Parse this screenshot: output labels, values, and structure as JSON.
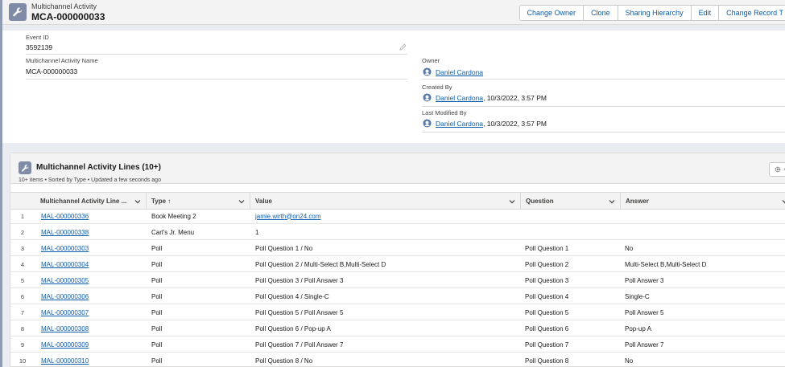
{
  "header": {
    "object_label": "Multichannel Activity",
    "record_title": "MCA-000000033",
    "icon": "wrench-icon",
    "actions": [
      "Change Owner",
      "Clone",
      "Sharing Hierarchy",
      "Edit",
      "Change Record T"
    ]
  },
  "detail": {
    "event_id_label": "Event ID",
    "event_id_value": "3592139",
    "name_label": "Multichannel Activity Name",
    "name_value": "MCA-000000033",
    "owner_label": "Owner",
    "owner_value": "Daniel Cardona",
    "created_label": "Created By",
    "created_user": "Daniel Cardona",
    "created_date": ", 10/3/2022, 3:57 PM",
    "modified_label": "Last Modified By",
    "modified_user": "Daniel Cardona",
    "modified_date": ", 10/3/2022, 3:57 PM"
  },
  "related_list": {
    "title": "Multichannel Activity Lines (10+)",
    "subtitle": "10+ items • Sorted by Type • Updated a few seconds ago",
    "columns": {
      "name": "Multichannel Activity Line ...",
      "type": "Type ↑",
      "value": "Value",
      "question": "Question",
      "answer": "Answer"
    },
    "rows": [
      {
        "num": "1",
        "name": "MAL-000000336",
        "type": "Book Meeting 2",
        "value": "jamie.wirth@on24.com",
        "question": "",
        "answer": ""
      },
      {
        "num": "2",
        "name": "MAL-000000338",
        "type": "Carl's Jr. Menu",
        "value": "1",
        "question": "",
        "answer": ""
      },
      {
        "num": "3",
        "name": "MAL-000000303",
        "type": "Poll",
        "value": "Poll Question 1 / No",
        "question": "Poll Question 1",
        "answer": "No"
      },
      {
        "num": "4",
        "name": "MAL-000000304",
        "type": "Poll",
        "value": "Poll Question 2 / Multi-Select B,Multi-Select D",
        "question": "Poll Question 2",
        "answer": "Multi-Select B,Multi-Select D"
      },
      {
        "num": "5",
        "name": "MAL-000000305",
        "type": "Poll",
        "value": "Poll Question 3 / Poll Answer 3",
        "question": "Poll Question 3",
        "answer": "Poll Answer 3"
      },
      {
        "num": "6",
        "name": "MAL-000000306",
        "type": "Poll",
        "value": "Poll Question 4 / Single-C",
        "question": "Poll Question 4",
        "answer": "Single-C"
      },
      {
        "num": "7",
        "name": "MAL-000000307",
        "type": "Poll",
        "value": "Poll Question 5 / Poll Answer 5",
        "question": "Poll Question 5",
        "answer": "Poll Answer 5"
      },
      {
        "num": "8",
        "name": "MAL-000000308",
        "type": "Poll",
        "value": "Poll Question 6 / Pop-up A",
        "question": "Poll Question 6",
        "answer": "Pop-up A"
      },
      {
        "num": "9",
        "name": "MAL-000000309",
        "type": "Poll",
        "value": "Poll Question 7 / Poll Answer 7",
        "question": "Poll Question 7",
        "answer": "Poll Answer 7"
      },
      {
        "num": "10",
        "name": "MAL-000000310",
        "type": "Poll",
        "value": "Poll Question 8 / No",
        "question": "Poll Question 8",
        "answer": "No"
      }
    ]
  },
  "colors": {
    "link": "#0b5cab",
    "icon_bg": "#7f8ba7",
    "border": "#dddbda"
  }
}
